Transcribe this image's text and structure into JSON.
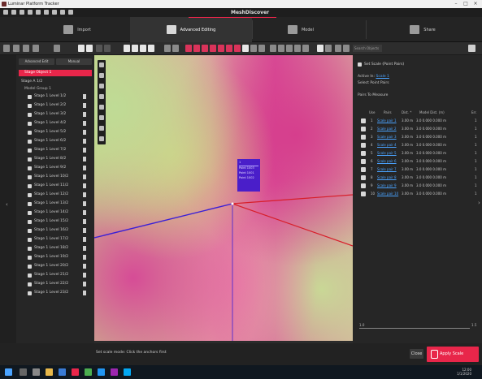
{
  "window": {
    "title": "Luminar Platform Tracker"
  },
  "app": {
    "brand": "MeshDiscover"
  },
  "modes": [
    {
      "label": "Import",
      "icon": "import-icon"
    },
    {
      "label": "Advanced Editing",
      "icon": "edit-icon"
    },
    {
      "label": "Model",
      "icon": "model-icon"
    },
    {
      "label": "Share",
      "icon": "share-icon"
    }
  ],
  "toolbar": {
    "search_placeholder": "Search Objects"
  },
  "left_panel": {
    "tabs": [
      "Advanced Edit",
      "Manual"
    ],
    "selected_item": "Stage Object 1",
    "group": "Stage A 1/2",
    "subgroup": "Model Group 1",
    "items": [
      "Stage 1 Level 1/2",
      "Stage 1 Level 2/2",
      "Stage 1 Level 3/2",
      "Stage 1 Level 4/2",
      "Stage 1 Level 5/2",
      "Stage 1 Level 6/2",
      "Stage 1 Level 7/2",
      "Stage 1 Level 8/2",
      "Stage 1 Level 9/2",
      "Stage 1 Level 10/2",
      "Stage 1 Level 11/2",
      "Stage 1 Level 12/2",
      "Stage 1 Level 13/2",
      "Stage 1 Level 14/2",
      "Stage 1 Level 15/2",
      "Stage 1 Level 16/2",
      "Stage 1 Level 17/2",
      "Stage 1 Level 18/2",
      "Stage 1 Level 19/2",
      "Stage 1 Level 20/2",
      "Stage 1 Level 21/2",
      "Stage 1 Level 22/2",
      "Stage 1 Level 23/2"
    ]
  },
  "viewport": {
    "label_lines": [
      "1",
      "Point 1003",
      "Point 1001",
      "Point 1002"
    ]
  },
  "right_panel": {
    "header": "Set Scale (Point Pairs)",
    "reference_prefix": "Active In:",
    "reference_link": "Scale 1",
    "reference_note": "Select Point Pairs",
    "table_title": "Pairs To Measure",
    "columns": [
      "Use",
      "Pairs",
      "Dist. *",
      "Model Dist. (m)",
      "Err."
    ],
    "rows": [
      {
        "num": "1",
        "name": "Scale pair 1",
        "dist": "3.00 m",
        "model": "3.0 0.000 0.000 m",
        "err": "1"
      },
      {
        "num": "2",
        "name": "Scale pair 2",
        "dist": "3.00 m",
        "model": "3.0 0.000 0.000 m",
        "err": "1"
      },
      {
        "num": "3",
        "name": "Scale pair 3",
        "dist": "3.00 m",
        "model": "3.0 0.000 0.000 m",
        "err": "1"
      },
      {
        "num": "4",
        "name": "Scale pair 4",
        "dist": "3.00 m",
        "model": "3.0 0.000 0.000 m",
        "err": "1"
      },
      {
        "num": "5",
        "name": "Scale pair 5",
        "dist": "3.00 m",
        "model": "3.0 0.000 0.000 m",
        "err": "1"
      },
      {
        "num": "6",
        "name": "Scale pair 6",
        "dist": "3.00 m",
        "model": "3.0 0.000 0.000 m",
        "err": "1"
      },
      {
        "num": "7",
        "name": "Scale pair 7",
        "dist": "3.00 m",
        "model": "3.0 0.000 0.000 m",
        "err": "1"
      },
      {
        "num": "8",
        "name": "Scale pair 8",
        "dist": "3.00 m",
        "model": "3.0 0.000 0.000 m",
        "err": "1"
      },
      {
        "num": "9",
        "name": "Scale pair 9",
        "dist": "3.00 m",
        "model": "3.0 0.000 0.000 m",
        "err": "1"
      },
      {
        "num": "10",
        "name": "Scale pair 10",
        "dist": "3.00 m",
        "model": "3.0 0.000 0.000 m",
        "err": "1"
      }
    ],
    "slider_min": "1.0",
    "slider_max": "1.5"
  },
  "status": {
    "message": "Set scale mode: Click the anchors first"
  },
  "buttons": {
    "close": "Close",
    "primary": "Apply Scale"
  },
  "taskbar": {
    "time": "12:00",
    "date": "1/1/2020"
  },
  "colors": {
    "accent": "#e8264a",
    "link": "#4aa3ff",
    "annotation": "#4a1ec9"
  }
}
